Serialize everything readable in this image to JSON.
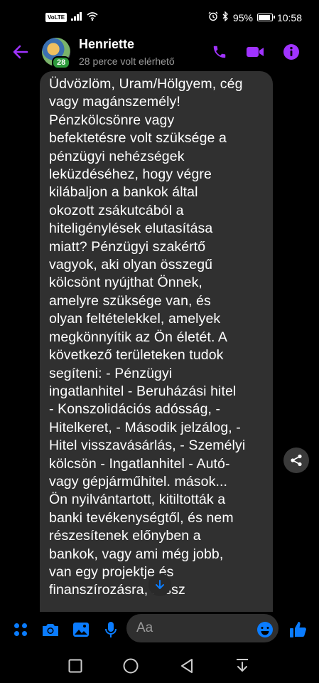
{
  "status_bar": {
    "volte": "VoLTE",
    "battery_percent": "95%",
    "battery_level": 0.95,
    "time": "10:58"
  },
  "header": {
    "contact_name": "Henriette",
    "last_seen": "28 perce volt elérhető",
    "avatar_badge": "28"
  },
  "message": {
    "text": "Üdvözlöm, Uram/Hölgyem, cég\nvagy magánszemély!\nPénzkölcsönre vagy\nbefektetésre volt szüksége a\npénzügyi nehézségek\nleküzdéséhez, hogy végre\nkilábaljon a bankok által\nokozott zsákutcából a\nhiteligénylések elutasítása\nmiatt?  Pénzügyi szakértő\nvagyok, aki olyan összegű\nkölcsönt nyújthat Önnek,\namelyre szüksége van, és\nolyan feltételekkel, amelyek\nmegkönnyítik az Ön életét.  A\nkövetkező területeken tudok\nsegíteni: - Pénzügyi\ningatlanhitel - Beruházási hitel\n- Konszolidációs adósság, -\nHitelkeret, - Második jelzálog, -\nHitel visszavásárlás, - Személyi\nkölcsön - Ingatlanhitel - Autó-\nvagy gépjárműhitel. mások...\nÖn nyilvántartott, kitiltották a\nbanki tevékenységtől, és nem\nrészesítenek előnyben a\nbankok, vagy ami még jobb,\nvan egy projektje és\nfinanszírozásra, rossz"
  },
  "composer": {
    "placeholder": "Aa"
  },
  "colors": {
    "accent": "#a033ff",
    "composer_blue": "#0a7cff",
    "bubble": "#303030"
  },
  "icons": {
    "back": "back-arrow-icon",
    "phone": "phone-icon",
    "video": "video-camera-icon",
    "info": "info-icon",
    "share": "share-icon",
    "scroll": "arrow-down-icon",
    "menu": "four-dots-icon",
    "camera": "camera-icon",
    "gallery": "image-icon",
    "mic": "microphone-icon",
    "emoji": "emoji-icon",
    "like": "thumbs-up-icon"
  }
}
